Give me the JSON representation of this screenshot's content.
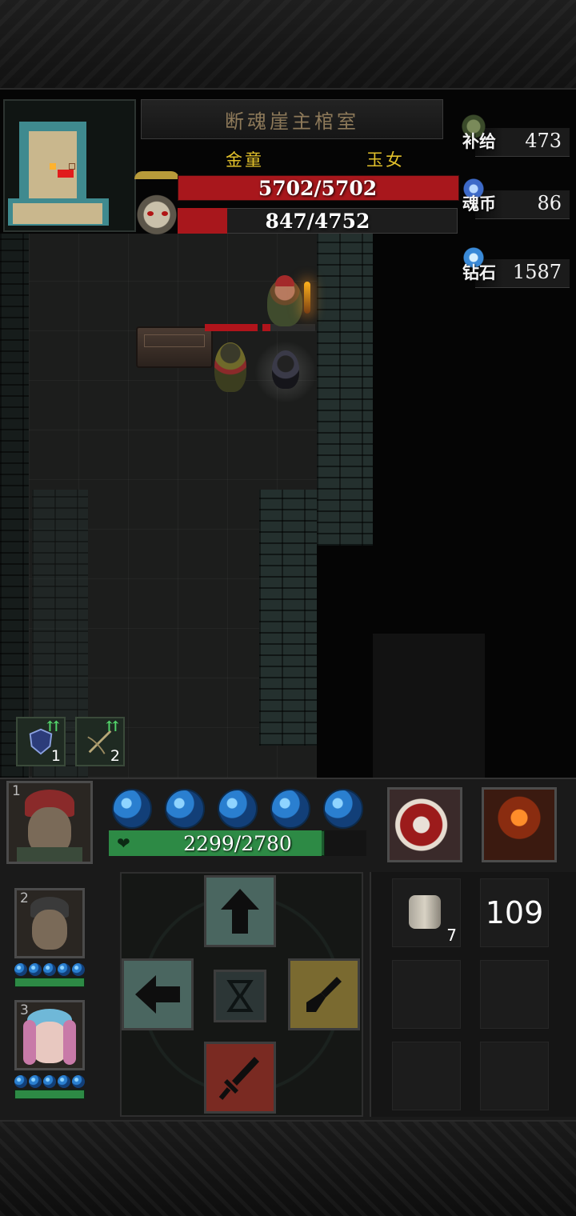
{
  "location": {
    "title": "断魂崖主棺室"
  },
  "bosses": [
    {
      "name": "金童",
      "hp_text": "5702/5702",
      "hp_fraction": 1.0
    },
    {
      "name": "玉女",
      "hp_text": "847/4752",
      "hp_fraction": 0.178
    }
  ],
  "resources": [
    {
      "label": "补给",
      "value": "473",
      "icon": "supply-pack-icon"
    },
    {
      "label": "魂币",
      "value": "86",
      "icon": "soul-coin-icon"
    },
    {
      "label": "钻石",
      "value": "1587",
      "icon": "diamond-icon"
    }
  ],
  "buffs": [
    {
      "icon": "shield-buff-icon",
      "count": "1"
    },
    {
      "icon": "crossbow-buff-icon",
      "count": "2"
    }
  ],
  "party": {
    "leader": {
      "slot": "1",
      "hp_text": "2299/2780",
      "hp_fraction": 0.827,
      "energy_orbs": 5
    },
    "members": [
      {
        "slot": "2",
        "energy_orbs": 5,
        "hp_fraction": 1.0
      },
      {
        "slot": "3",
        "energy_orbs": 5,
        "hp_fraction": 1.0
      }
    ]
  },
  "skills": [
    {
      "icon": "whirlwind-slash-icon"
    },
    {
      "icon": "rage-fighter-icon"
    }
  ],
  "controls": {
    "up": "up-arrow-icon",
    "left": "left-arrow-icon",
    "wait": "hourglass-icon",
    "dig": "shovel-icon",
    "attack": "dagger-icon"
  },
  "inventory": [
    {
      "icon": "bandage-roll-icon",
      "count": "7"
    },
    {
      "icon": "counter",
      "count": "109"
    }
  ],
  "colors": {
    "boss_hp": "#a8171c",
    "player_hp": "#2d8a45",
    "boss_name": "#e2c12b",
    "energy_orb": "#2a7fd0"
  }
}
